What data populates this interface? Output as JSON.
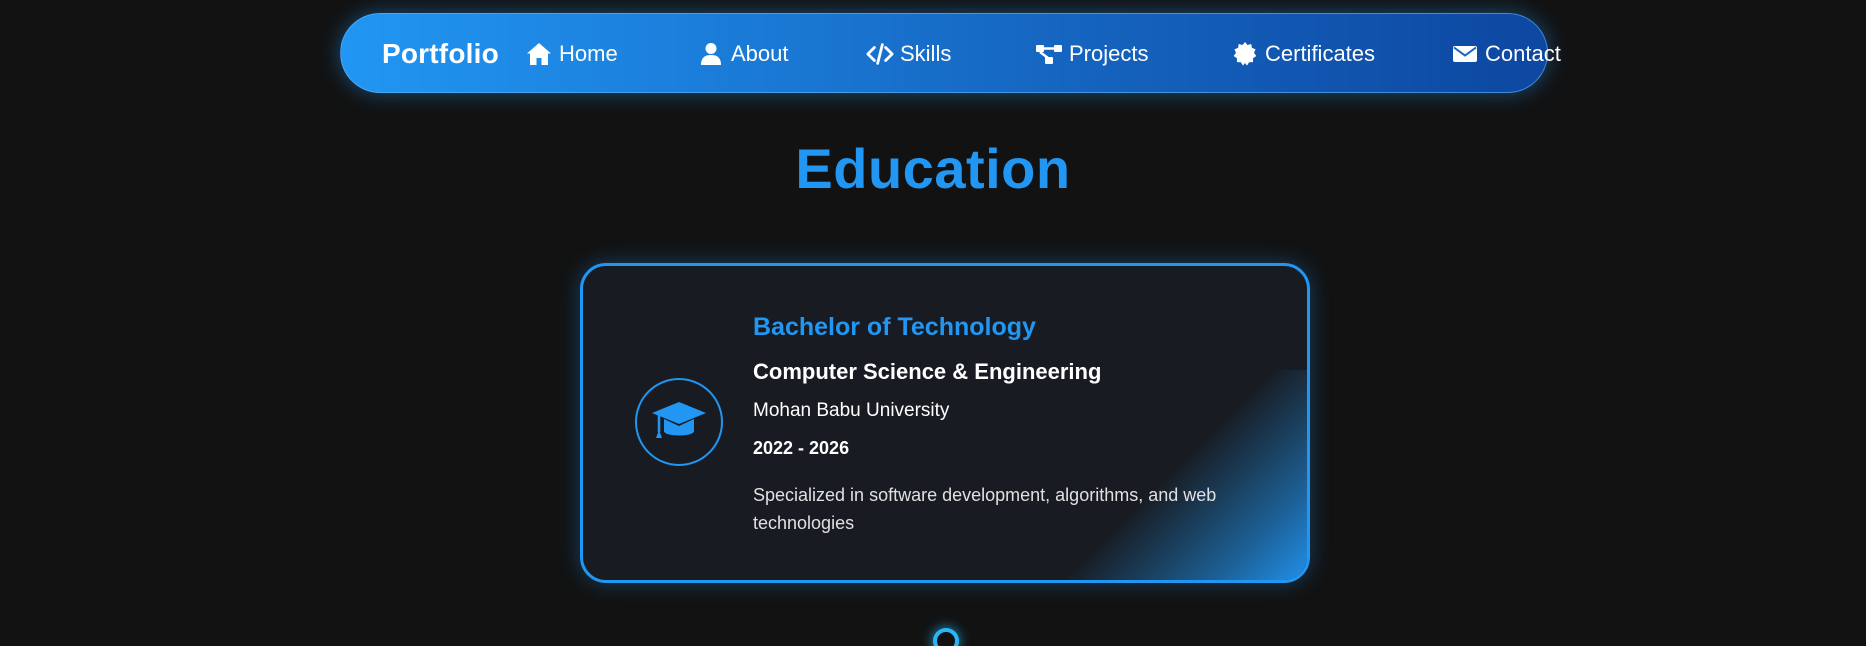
{
  "navbar": {
    "brand": "Portfolio",
    "items": [
      {
        "label": "Home",
        "icon": "home-icon"
      },
      {
        "label": "About",
        "icon": "user-icon"
      },
      {
        "label": "Skills",
        "icon": "code-icon"
      },
      {
        "label": "Projects",
        "icon": "project-diagram-icon"
      },
      {
        "label": "Certificates",
        "icon": "certificate-icon"
      },
      {
        "label": "Contact",
        "icon": "envelope-icon"
      }
    ]
  },
  "education": {
    "title": "Education",
    "card": {
      "icon": "graduation-cap-icon",
      "degree": "Bachelor of Technology",
      "field": "Computer Science & Engineering",
      "university": "Mohan Babu University",
      "years": "2022 - 2026",
      "description": "Specialized in software development, algorithms, and web technologies"
    }
  },
  "colors": {
    "background": "#121212",
    "accent": "#2196f3",
    "card_bg": "#181c22",
    "nav_gradient_start": "#2196f3",
    "nav_gradient_end": "#0d47a1"
  }
}
